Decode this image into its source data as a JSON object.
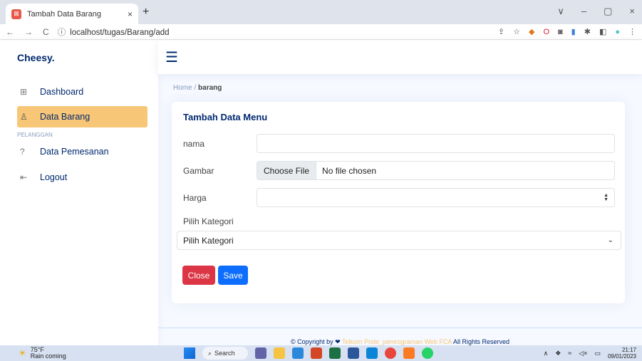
{
  "browser": {
    "tab_title": "Tambah Data Barang",
    "tab_close": "×",
    "new_tab": "+",
    "url": "localhost/tugas/Barang/add",
    "window_controls": [
      "∨",
      "–",
      "▢",
      "×"
    ]
  },
  "app": {
    "brand": "Cheesy.",
    "menu_icon": "hamburger-icon"
  },
  "sidebar": {
    "items": [
      {
        "label": "Dashboard",
        "icon": "grid-icon",
        "active": false
      },
      {
        "label": "Data Barang",
        "icon": "user-icon",
        "active": true
      }
    ],
    "heading": "PELANGGAN",
    "items2": [
      {
        "label": "Data Pemesanan",
        "icon": "question-icon"
      },
      {
        "label": "Logout",
        "icon": "logout-icon"
      }
    ]
  },
  "breadcrumb": {
    "home": "Home",
    "separator": "/",
    "current": "barang"
  },
  "form": {
    "title": "Tambah Data Menu",
    "nama_label": "nama",
    "nama_value": "",
    "gambar_label": "Gambar",
    "file_button": "Choose File",
    "file_status": "No file chosen",
    "harga_label": "Harga",
    "harga_value": "",
    "kategori_label": "Pilih Kategori",
    "kategori_selected": "Pilih Kategori",
    "close_button": "Close",
    "save_button": "Save"
  },
  "footer": {
    "prefix": "© Copyright by",
    "link": "Telkom Pride_pemrograman Web FCA",
    "suffix": "All Rights Reserved"
  },
  "taskbar": {
    "temp": "75°F",
    "weather": "Rain coming",
    "search": "Search",
    "time": "21:17",
    "date": "09/01/2023"
  },
  "colors": {
    "accent": "#f7c676",
    "brand": "#012970",
    "close": "#dc3545",
    "save": "#0d6efd"
  }
}
